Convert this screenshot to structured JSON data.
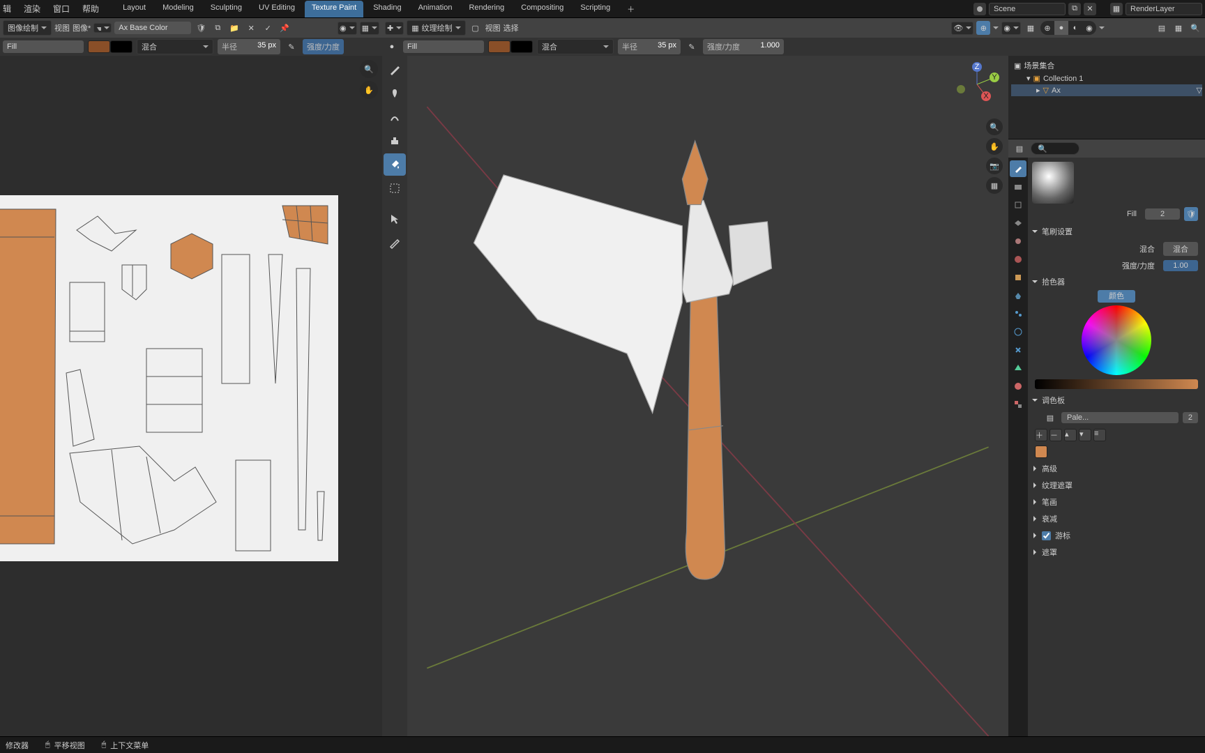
{
  "sys_menu": [
    "辑",
    "渲染",
    "窗口",
    "帮助"
  ],
  "workspaces": [
    "Layout",
    "Modeling",
    "Sculpting",
    "UV Editing",
    "Texture Paint",
    "Shading",
    "Animation",
    "Rendering",
    "Compositing",
    "Scripting"
  ],
  "active_workspace": "Texture Paint",
  "scene_name": "Scene",
  "render_layer": "RenderLayer",
  "img_editor": {
    "mode": "图像绘制",
    "menus": [
      "视图",
      "图像*"
    ],
    "image_name": "Ax Base Color",
    "brush_name": "Fill",
    "blend": "混合",
    "radius_label": "半径",
    "radius": "35 px",
    "strength_label": "强度/力度"
  },
  "viewport": {
    "mode": "纹理绘制",
    "menus": [
      "视图",
      "选择"
    ],
    "brush_name": "Fill",
    "blend": "混合",
    "radius_label": "半径",
    "radius": "35 px",
    "strength_label": "强度/力度",
    "strength": "1.000"
  },
  "outliner": {
    "scene_collection": "场景集合",
    "collection": "Collection 1",
    "object": "Ax"
  },
  "props": {
    "tool_name": "Fill",
    "tool_count": "2",
    "brush_settings": "笔刷设置",
    "blend_label": "混合",
    "blend_value": "混合",
    "strength_label": "强度/力度",
    "strength_value": "1.00",
    "color_picker": "拾色器",
    "color_btn": "颜色",
    "palette_label": "调色板",
    "palette_name": "Pale...",
    "palette_count": "2",
    "sections": [
      "高级",
      "纹理遮罩",
      "笔画",
      "衰减",
      "游标",
      "遮罩"
    ]
  },
  "status": {
    "modifier": "修改器",
    "pan": "平移视图",
    "context": "上下文菜单"
  }
}
